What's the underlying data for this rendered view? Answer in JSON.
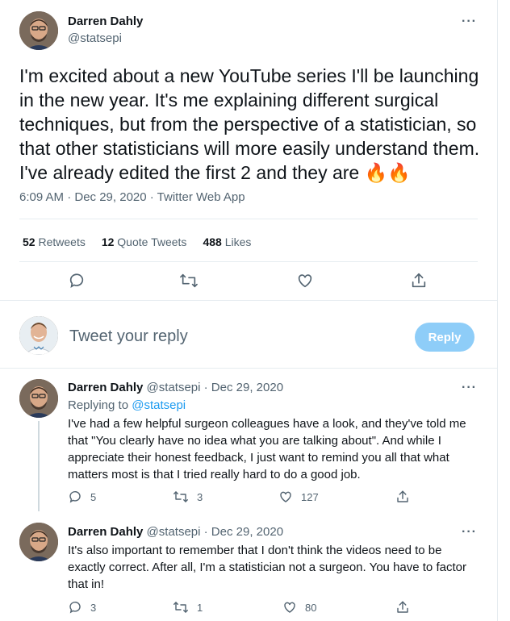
{
  "main_tweet": {
    "author_name": "Darren Dahly",
    "author_handle": "@statsepi",
    "text": "I'm excited about a new YouTube series I'll be launching in the new year. It's me explaining different surgical techniques, but from the perspective of a statistician, so that other statisticians will more easily understand them. I've already edited the first 2 and they are 🔥🔥",
    "timestamp": "6:09 AM · Dec 29, 2020 · Twitter Web App",
    "retweets_count": "52",
    "retweets_label": "Retweets",
    "quote_count": "12",
    "quote_label": "Quote Tweets",
    "likes_count": "488",
    "likes_label": "Likes"
  },
  "composer": {
    "placeholder": "Tweet your reply",
    "button_label": "Reply"
  },
  "replies": [
    {
      "author_name": "Darren Dahly",
      "author_handle": "@statsepi",
      "date": "· Dec 29, 2020",
      "replying_prefix": "Replying to",
      "replying_to": "@statsepi",
      "text": "I've had a few helpful surgeon colleagues have a look, and they've told me that \"You clearly have no idea what you are talking about\". And while I appreciate their honest feedback, I just want to remind you all that what matters most is that I tried really hard to do a good job.",
      "reply_count": "5",
      "retweet_count": "3",
      "like_count": "127"
    },
    {
      "author_name": "Darren Dahly",
      "author_handle": "@statsepi",
      "date": "· Dec 29, 2020",
      "text": "It's also important to remember that I don't think the videos need to be exactly correct. After all, I'm a statistician not a surgeon. You have to factor that in!",
      "reply_count": "3",
      "retweet_count": "1",
      "like_count": "80"
    }
  ],
  "colors": {
    "accent": "#1d9bf0",
    "reply_button_disabled": "#8ecdf8",
    "secondary_text": "#536471",
    "divider": "#e6ecf0"
  },
  "icons": [
    "more-icon",
    "reply-icon",
    "retweet-icon",
    "like-icon",
    "share-icon"
  ]
}
